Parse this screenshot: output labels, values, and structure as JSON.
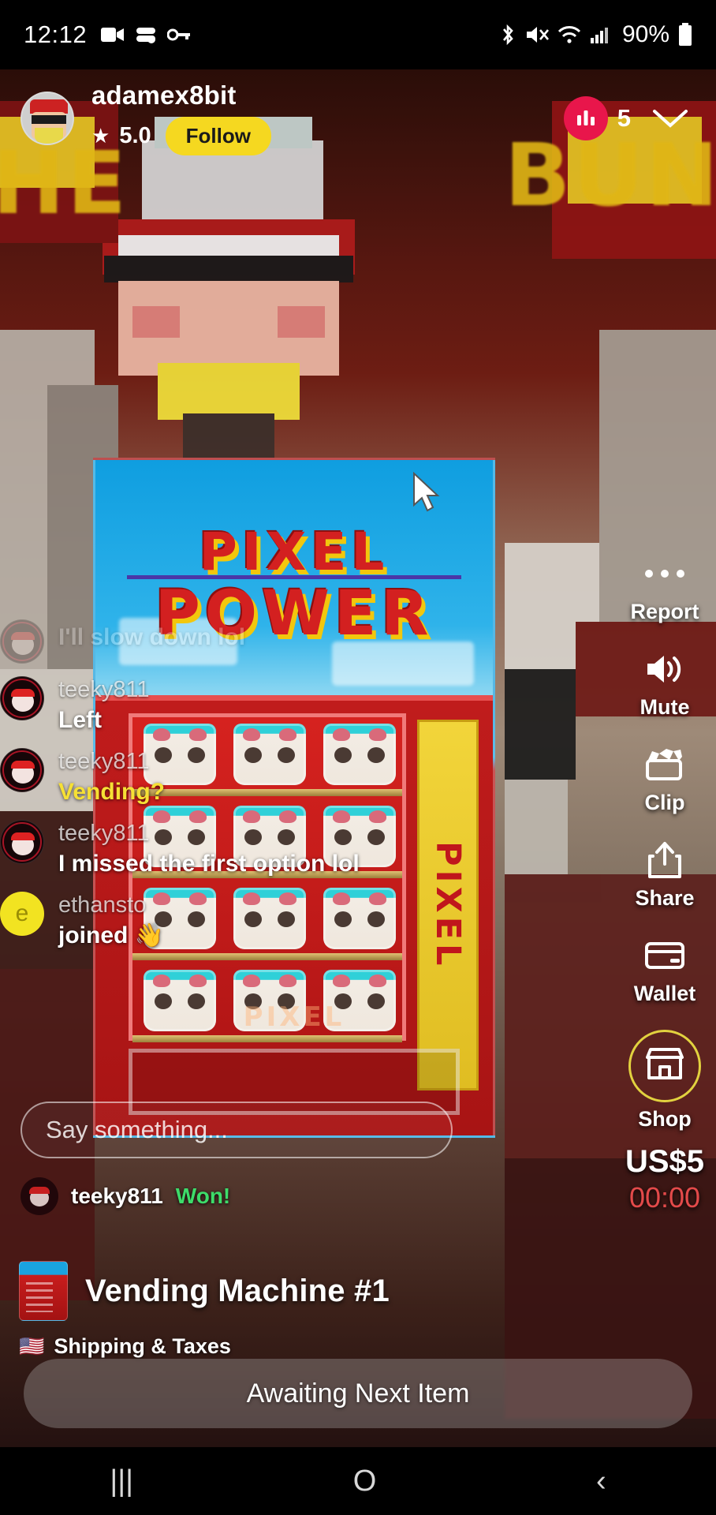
{
  "status_bar": {
    "time": "12:12",
    "battery_percent": "90%",
    "left_icons": [
      "video-recorder-icon",
      "screen-record-icon",
      "vpn-key-icon"
    ],
    "right_icons": [
      "bluetooth-icon",
      "volume-mute-icon",
      "wifi-icon",
      "cellular-signal-icon",
      "battery-icon"
    ]
  },
  "header": {
    "host_username": "adamex8bit",
    "rating": "5.0",
    "star_glyph": "★",
    "follow_label": "Follow",
    "viewer_count": "5",
    "viewer_icon": "audience-bars-icon",
    "collapse_icon": "chevron-down-icon",
    "avatar_name": "host-avatar"
  },
  "stream": {
    "vending_machine": {
      "title_line1": "PIXEL",
      "title_line2": "POWER",
      "side_label": "PIXEL",
      "bottom_logo": "PIXEL"
    }
  },
  "chat": {
    "messages": [
      {
        "user": "",
        "text": "I'll slow down lol",
        "style": "faded",
        "avatar": "teeky-avatar"
      },
      {
        "user": "teeky811",
        "text": "Left",
        "style": "normal",
        "avatar": "teeky-avatar"
      },
      {
        "user": "teeky811",
        "text": "Vending?",
        "style": "gold",
        "avatar": "teeky-avatar"
      },
      {
        "user": "teeky811",
        "text": "I missed the first option lol",
        "style": "normal",
        "avatar": "teeky-avatar"
      },
      {
        "user": "ethansto",
        "text": "joined 👋",
        "style": "normal",
        "avatar": "ethansto-avatar",
        "avatar_letter": "e"
      }
    ],
    "composer_placeholder": "Say something...",
    "won_notice": {
      "user": "teeky811",
      "label": "Won!"
    }
  },
  "product": {
    "name": "Vending Machine #1",
    "thumbnail": "vending-machine-thumbnail",
    "shipping_flag": "🇺🇸",
    "shipping_label": "Shipping & Taxes"
  },
  "rail": {
    "items": [
      {
        "label": "Report",
        "icon": "more-options-icon"
      },
      {
        "label": "Mute",
        "icon": "speaker-volume-icon"
      },
      {
        "label": "Clip",
        "icon": "clapperboard-icon"
      },
      {
        "label": "Share",
        "icon": "share-upload-icon"
      },
      {
        "label": "Wallet",
        "icon": "credit-card-icon"
      },
      {
        "label": "Shop",
        "icon": "storefront-icon"
      }
    ],
    "price": "US$5",
    "timer": "00:00"
  },
  "bottom_bar": {
    "status_label": "Awaiting Next Item"
  },
  "nav_bar": {
    "recents_icon": "|||",
    "home_icon": "O",
    "back_icon": "‹"
  },
  "colors": {
    "follow_yellow": "#f5d820",
    "live_red": "#e8164b",
    "won_green": "#3ddc6a",
    "gold_text": "#f6e035",
    "timer_red": "#e34a4a",
    "shop_ring": "#e2d23f"
  }
}
